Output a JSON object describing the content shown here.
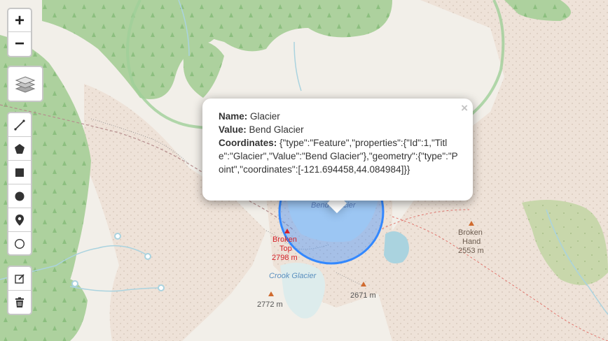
{
  "zoom": {
    "in_label": "+",
    "out_label": "−"
  },
  "layers_icon": "layers-icon",
  "draw_tools": [
    "polyline-icon",
    "polygon-icon",
    "rectangle-icon",
    "circle-icon",
    "marker-icon",
    "circlemarker-icon"
  ],
  "edit_tools": [
    "edit-icon",
    "trash-icon"
  ],
  "popup": {
    "close": "×",
    "name_label": "Name:",
    "name_value": "Glacier",
    "value_label": "Value:",
    "value_value": "Bend Glacier",
    "coords_label": "Coordinates:",
    "coords_value": "{\"type\":\"Feature\",\"properties\":{\"Id\":1,\"Title\":\"Glacier\",\"Value\":\"Bend Glacier\"},\"geometry\":{\"type\":\"Point\",\"coordinates\":[-121.694458,44.084984]}}"
  },
  "labels": {
    "bend_glacier": "Bend Glacier",
    "broken_top_1": "Broken",
    "broken_top_2": "Top",
    "broken_top_elev": "2798 m",
    "crook_glacier": "Crook Glacier",
    "broken_hand_1": "Broken",
    "broken_hand_2": "Hand",
    "broken_hand_elev": "2553 m",
    "peak_2772": "2772 m",
    "peak_2671": "2671 m"
  },
  "colors": {
    "forest": "#add19e",
    "glacier": "#ddecec",
    "water": "#aad3df",
    "selection": "#3388ff",
    "peak": "#d06b2f",
    "summit_label": "#d4222a"
  }
}
